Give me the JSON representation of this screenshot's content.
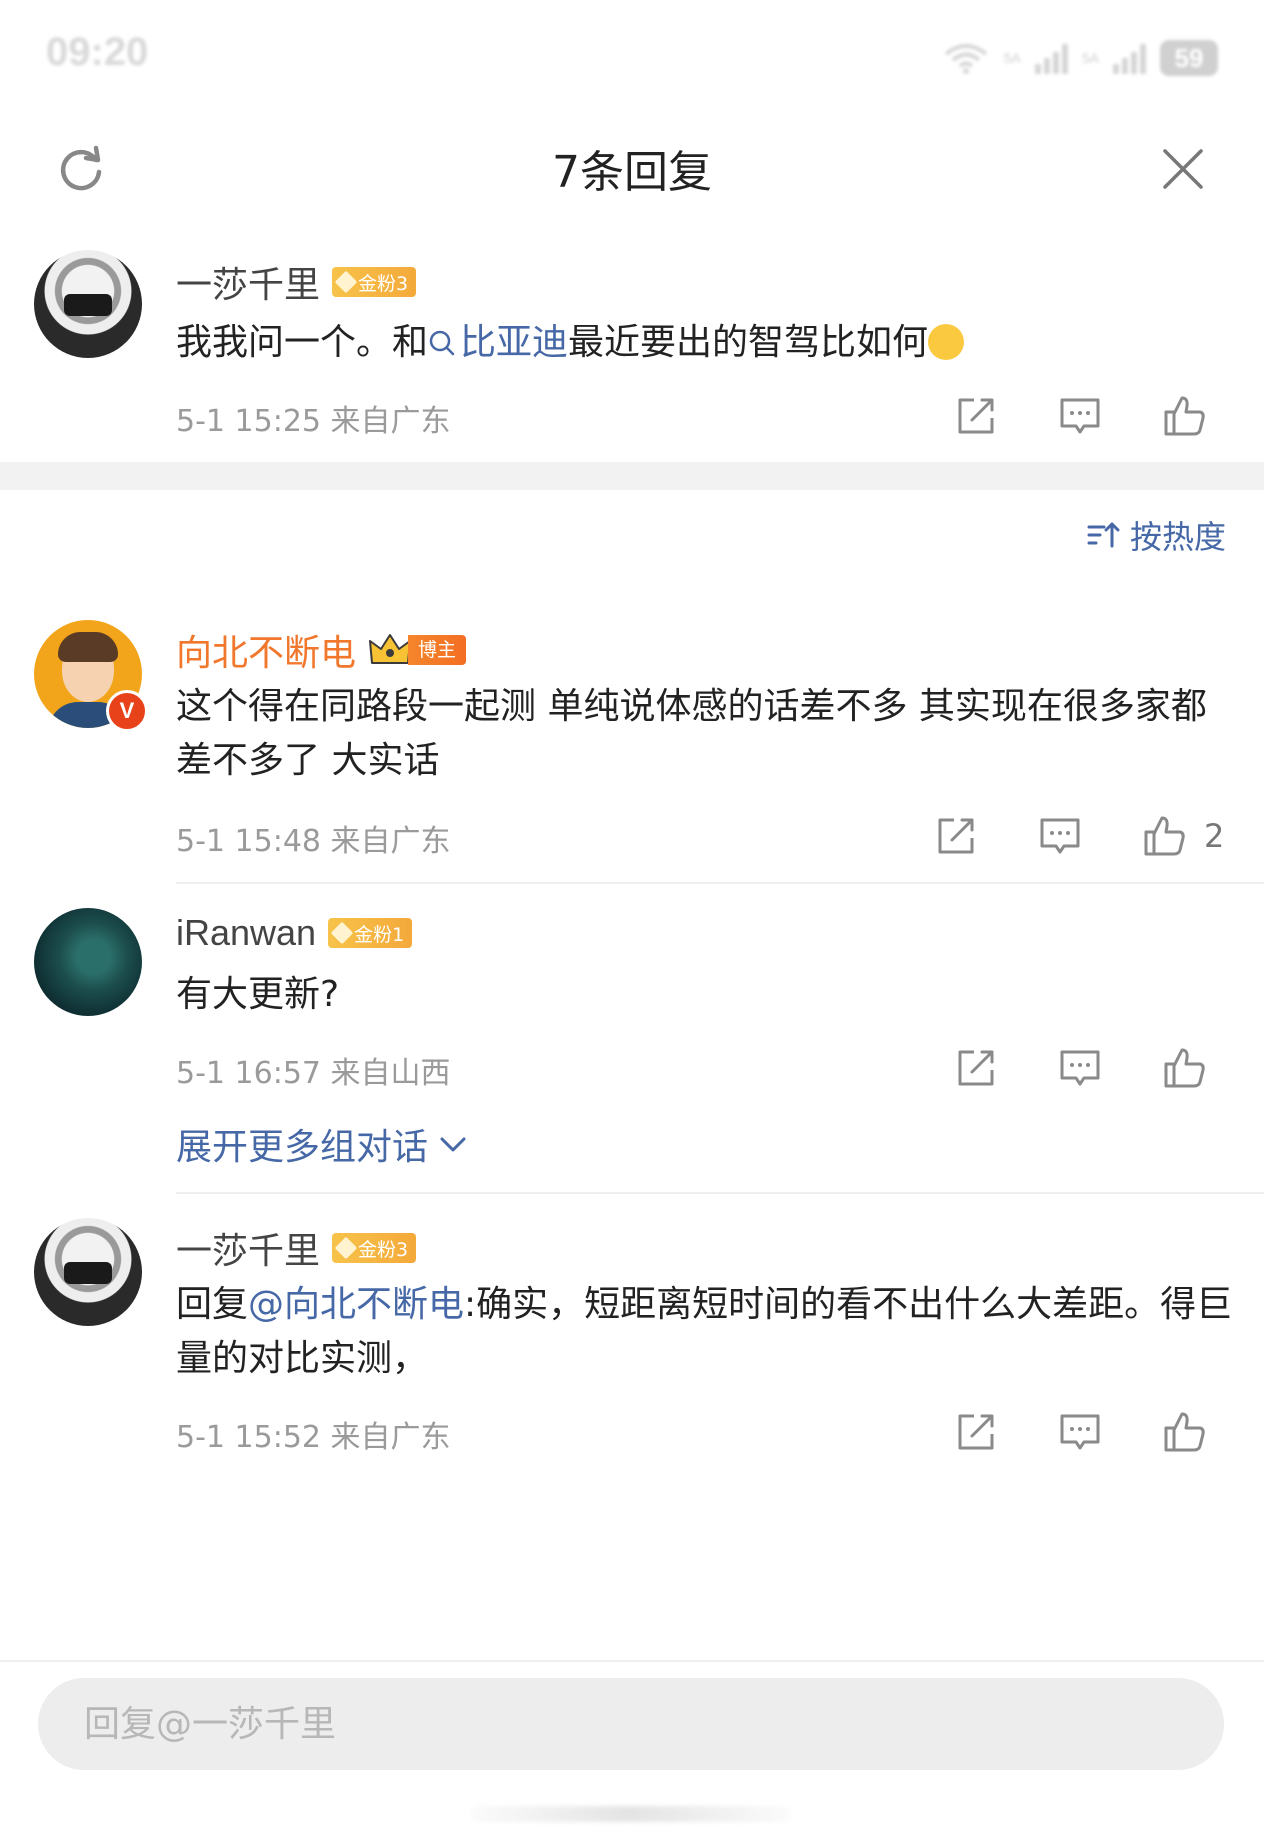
{
  "status_bar": {
    "time": "09:20",
    "network_1": "5A",
    "network_2": "5A",
    "battery": "59"
  },
  "header": {
    "title": "7条回复"
  },
  "root_comment": {
    "username": "一莎千里",
    "badge": "金粉3",
    "text_before": "我我问一个。和",
    "topic_link": "比亚迪",
    "text_after": "最近要出的智驾比如何",
    "emoji": "smiling-face",
    "meta": "5-1 15:25 来自广东"
  },
  "sort": {
    "label": "按热度"
  },
  "replies": [
    {
      "username": "向北不断电",
      "badge": "博主",
      "verified": "V",
      "text": "这个得在同路段一起测 单纯说体感的话差不多 其实现在很多家都差不多了 大实话",
      "meta": "5-1 15:48 来自广东",
      "likes": "2"
    },
    {
      "username": "iRanwan",
      "badge": "金粉1",
      "text": "有大更新?",
      "meta": "5-1 16:57 来自山西",
      "expand_label": "展开更多组对话"
    },
    {
      "username": "一莎千里",
      "badge": "金粉3",
      "reply_prefix": "回复",
      "mention": "@向北不断电",
      "text": ":确实，短距离短时间的看不出什么大差距。得巨量的对比实测，",
      "meta": "5-1 15:52 来自广东"
    }
  ],
  "reply_box": {
    "placeholder": "回复@一莎千里"
  },
  "colors": {
    "link": "#4668a6",
    "vip_name": "#f0772b",
    "fan_badge": "#f4a93a",
    "meta_text": "#9a9a9a"
  }
}
